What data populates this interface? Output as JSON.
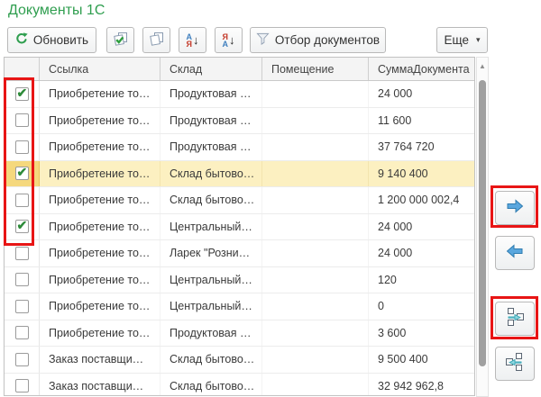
{
  "title": "Документы 1С",
  "toolbar": {
    "refresh": "Обновить",
    "filter": "Отбор документов",
    "more": "Еще",
    "more_caret": "▾",
    "sort_asc_top": "А",
    "sort_asc_bottom": "Я",
    "sort_desc_top": "Я",
    "sort_desc_bottom": "А"
  },
  "icons": {
    "refresh": "green-circular-arrow",
    "check_all": "stacked-pages-with-green-check",
    "uncheck_all": "stacked-pages",
    "sort_asc": "letters-A-Ya-down-arrow",
    "sort_desc": "letters-Ya-A-down-arrow",
    "filter": "funnel",
    "scroll_up": "▲",
    "move_right": "blue-arrow-right",
    "move_left": "blue-arrow-left",
    "move_all_right": "squares-with-teal-arrow-right",
    "move_all_left": "squares-with-teal-arrow-left"
  },
  "table": {
    "columns": [
      "Ссылка",
      "Склад",
      "Помещение",
      "СуммаДокумента"
    ],
    "rows": [
      {
        "checked": true,
        "selected": false,
        "link": "Приобретение то…",
        "warehouse": "Продуктовая …",
        "room": "",
        "amount": "24 000"
      },
      {
        "checked": false,
        "selected": false,
        "link": "Приобретение то…",
        "warehouse": "Продуктовая …",
        "room": "",
        "amount": "11 600"
      },
      {
        "checked": false,
        "selected": false,
        "link": "Приобретение то…",
        "warehouse": "Продуктовая …",
        "room": "",
        "amount": "37 764 720"
      },
      {
        "checked": true,
        "selected": true,
        "link": "Приобретение то…",
        "warehouse": "Склад бытово…",
        "room": "",
        "amount": "9 140 400"
      },
      {
        "checked": false,
        "selected": false,
        "link": "Приобретение то…",
        "warehouse": "Склад бытово…",
        "room": "",
        "amount": "1 200 000 002,4"
      },
      {
        "checked": true,
        "selected": false,
        "link": "Приобретение то…",
        "warehouse": "Центральный…",
        "room": "",
        "amount": "24 000"
      },
      {
        "checked": false,
        "selected": false,
        "link": "Приобретение то…",
        "warehouse": "Ларек \"Розни…",
        "room": "",
        "amount": "24 000"
      },
      {
        "checked": false,
        "selected": false,
        "link": "Приобретение то…",
        "warehouse": "Центральный…",
        "room": "",
        "amount": "120"
      },
      {
        "checked": false,
        "selected": false,
        "link": "Приобретение то…",
        "warehouse": "Центральный…",
        "room": "",
        "amount": "0"
      },
      {
        "checked": false,
        "selected": false,
        "link": "Приобретение то…",
        "warehouse": "Продуктовая …",
        "room": "",
        "amount": "3 600"
      },
      {
        "checked": false,
        "selected": false,
        "link": "Заказ поставщи…",
        "warehouse": "Склад бытово…",
        "room": "",
        "amount": "9 500 400"
      },
      {
        "checked": false,
        "selected": false,
        "link": "Заказ поставщи…",
        "warehouse": "Склад бытово…",
        "room": "",
        "amount": "32 942 962,8"
      }
    ]
  },
  "side_panel": {
    "buttons": [
      {
        "name": "move-selected-right",
        "icon": "blue-arrow-right"
      },
      {
        "name": "move-selected-left",
        "icon": "blue-arrow-left"
      },
      {
        "name": "move-all-right",
        "icon": "squares-with-teal-arrow-right"
      },
      {
        "name": "move-all-left",
        "icon": "squares-with-teal-arrow-left"
      }
    ]
  },
  "annotations": [
    {
      "target": "checkbox-column-rows-1-to-6",
      "color": "#e81515"
    },
    {
      "target": "move-selected-right-button",
      "color": "#e81515"
    },
    {
      "target": "move-all-right-button",
      "color": "#e81515"
    }
  ],
  "colors": {
    "title_green": "#2f9e4f",
    "check_green": "#2e8b3a",
    "arrow_blue": "#5aa7de",
    "teal_arrow": "#8fd8e0",
    "selected_row_bg": "#fcf0c1",
    "selected_checkbox_cell_bg": "#f5d87d",
    "annotation_red": "#e81515",
    "header_bg": "#f4f4f4"
  }
}
